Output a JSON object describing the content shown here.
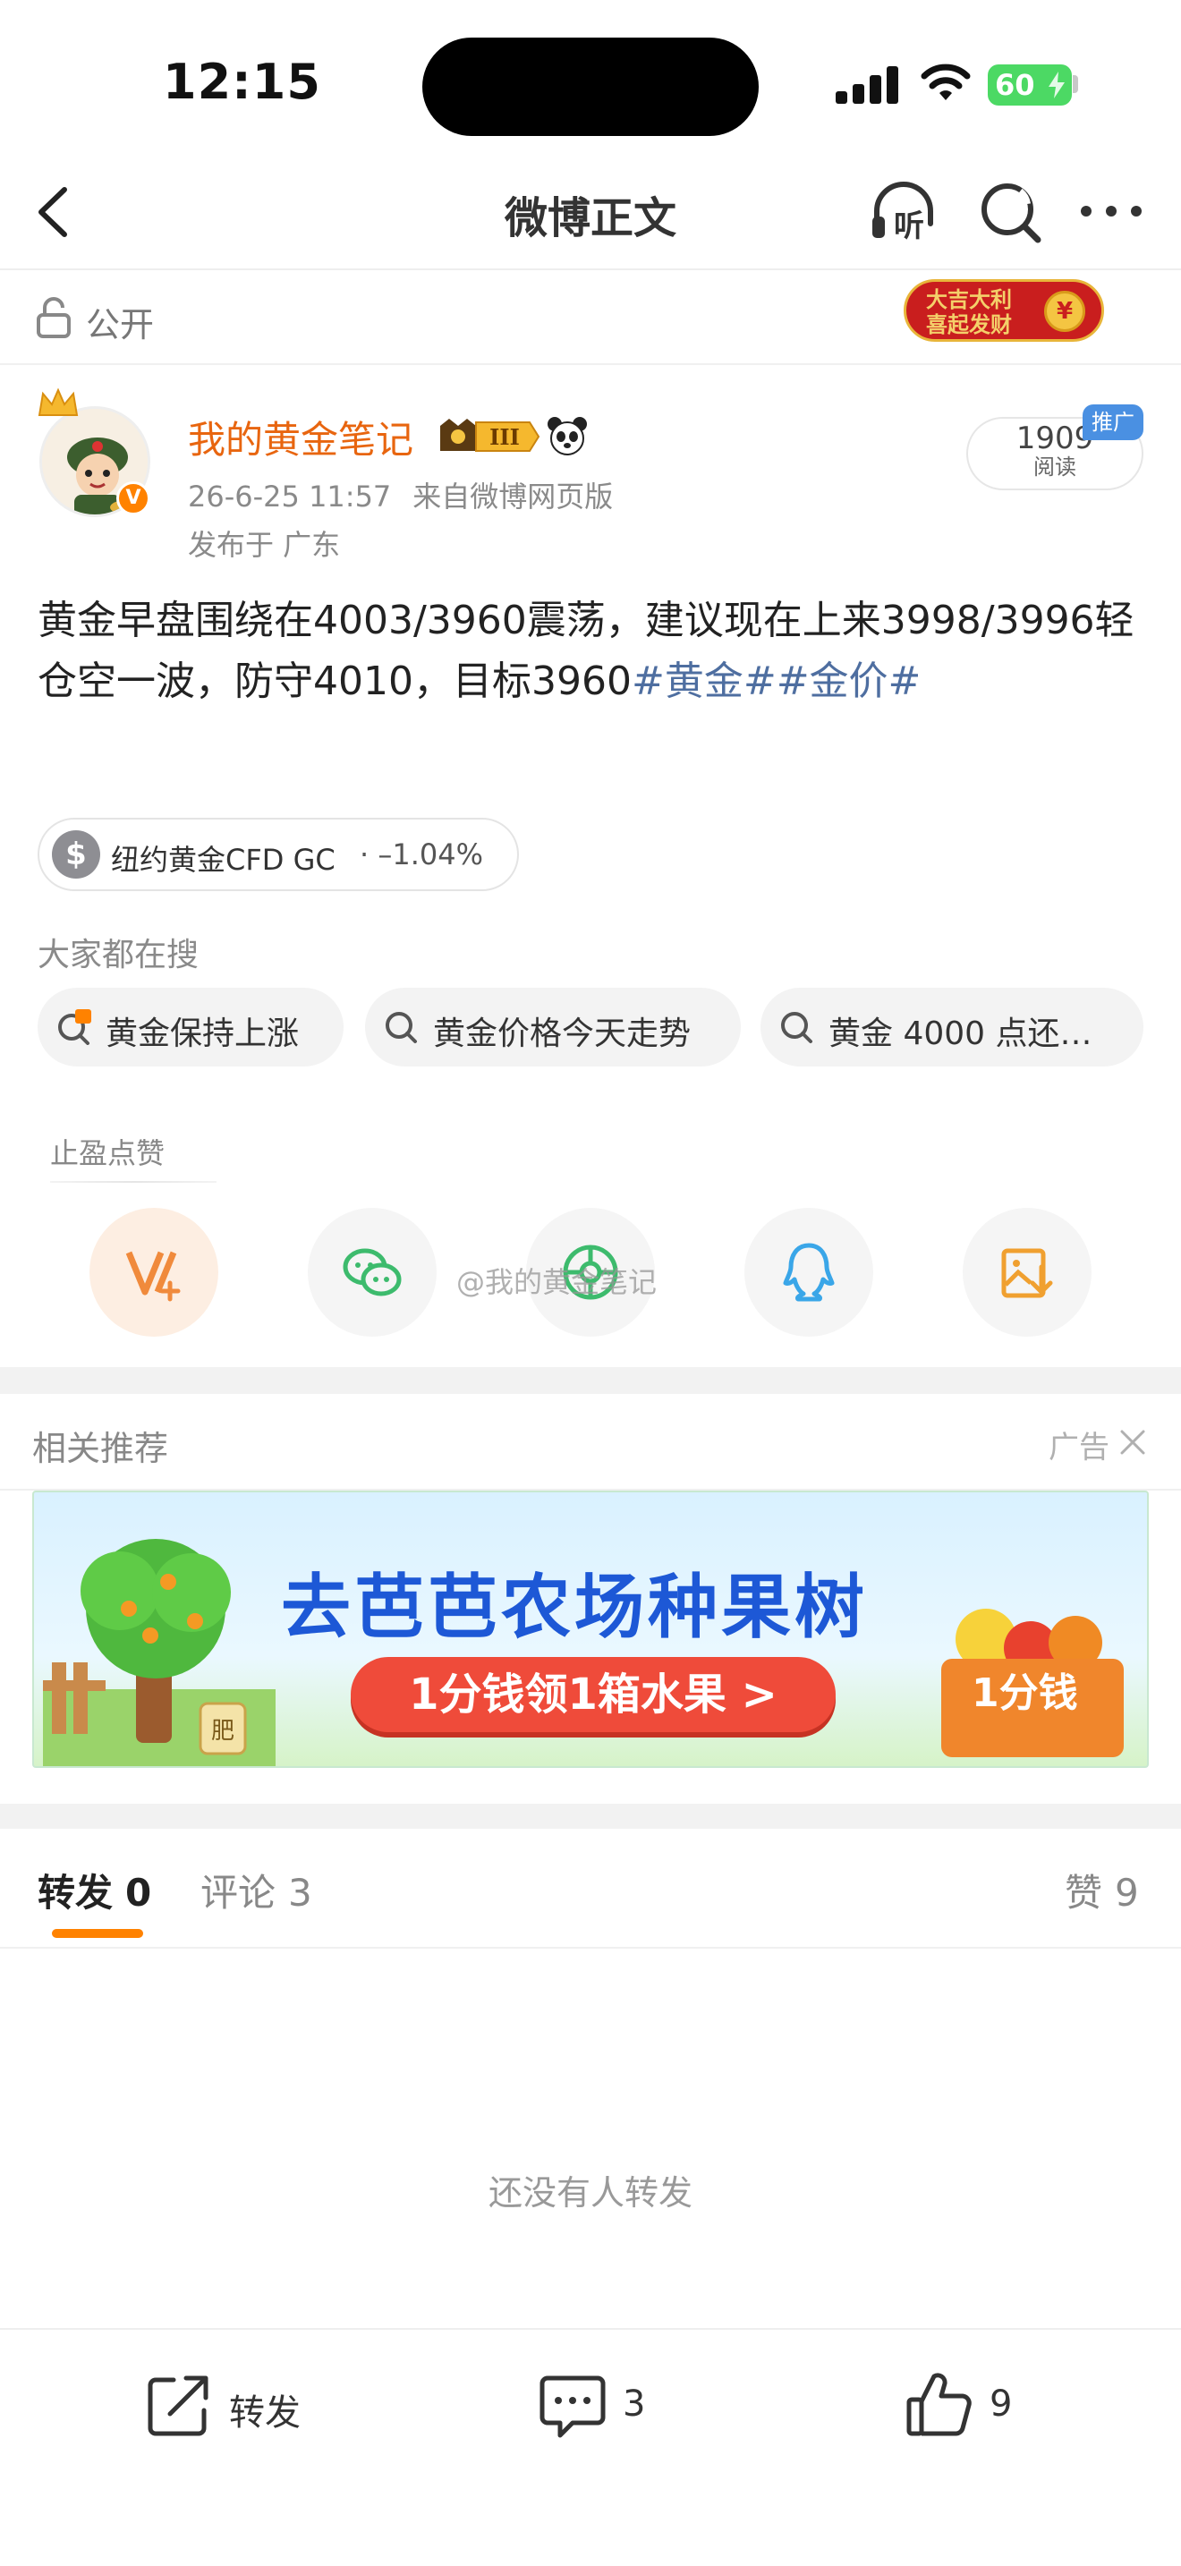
{
  "status_bar": {
    "time": "12:15",
    "battery": "60"
  },
  "nav": {
    "title": "微博正文",
    "listen_label": "听"
  },
  "visibility": {
    "label": "公开",
    "festival_text": "大吉大利 喜起发财"
  },
  "author": {
    "name": "我的黄金笔记",
    "level": "III",
    "verified_mark": "V",
    "date": "26-6-25 11:57",
    "source": "来自微博网页版",
    "location": "发布于 广东",
    "read_count": "1909",
    "read_label": "阅读",
    "promo_label": "推广"
  },
  "post": {
    "text": "黄金早盘围绕在4003/3960震荡，建议现在上来3998/3996轻仓空一波，防守4010，目标3960",
    "hashtags": [
      "#黄金#",
      "#金价#"
    ]
  },
  "stock": {
    "symbol_icon": "$",
    "name": "纽约黄金CFD GC",
    "change": "· –1.04%"
  },
  "searches": {
    "title": "大家都在搜",
    "items": [
      {
        "label": "黄金保持上涨",
        "icon": "hot-search-icon"
      },
      {
        "label": "黄金价格今天走势",
        "icon": "search-icon"
      },
      {
        "label": "黄金 4000 点还…",
        "icon": "search-icon"
      }
    ]
  },
  "share": {
    "tip": "止盈点赞",
    "watermark": "@我的黄金笔记",
    "buttons": [
      "vplus-icon",
      "wechat-icon",
      "moments-icon",
      "qq-icon",
      "save-image-icon"
    ]
  },
  "related": {
    "title": "相关推荐",
    "ad_label": "广告",
    "ad_headline": "去芭芭农场种果树",
    "ad_cta": "1分钱领1箱水果 >",
    "ad_basket_label": "1分钱",
    "ad_bag_label": "肥"
  },
  "tabs": {
    "repost": {
      "label": "转发",
      "count": "0"
    },
    "comment": {
      "label": "评论",
      "count": "3"
    },
    "like": {
      "label": "赞",
      "count": "9"
    }
  },
  "empty_state": "还没有人转发",
  "bottom_bar": {
    "repost_label": "转发",
    "comment_count": "3",
    "like_count": "9"
  },
  "colors": {
    "accent_orange": "#ff8200",
    "author_name": "#e8650f",
    "hashtag": "#4e6ea0",
    "promo_badge": "#4a90e2"
  }
}
